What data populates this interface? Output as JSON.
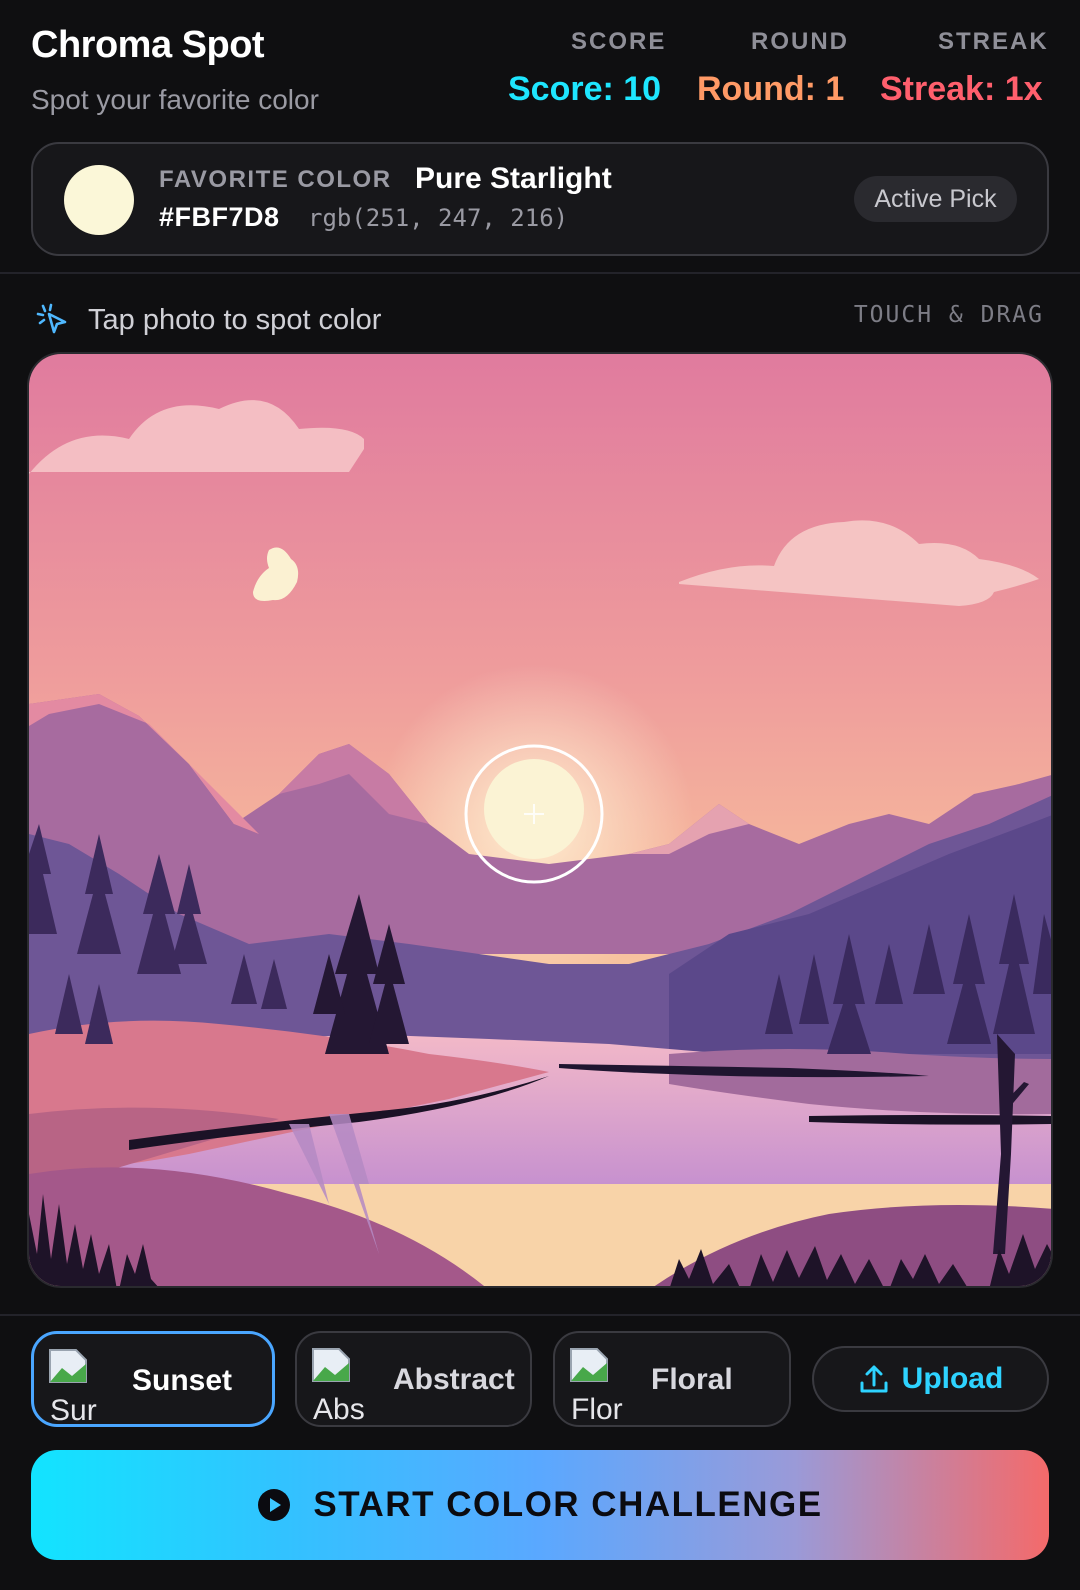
{
  "app": {
    "title": "Chroma Spot",
    "subtitle": "Spot your favorite color"
  },
  "stats": {
    "score_label": "SCORE",
    "round_label": "ROUND",
    "streak_label": "STREAK",
    "score_text": "Score: 10",
    "round_text": "Round: 1",
    "streak_text": "Streak: 1x",
    "score_color": "#1ee6ff",
    "round_color": "#ff9a66",
    "streak_color": "#ff5f6d"
  },
  "favorite": {
    "label": "FAVORITE COLOR",
    "name": "Pure Starlight",
    "hex": "#FBF7D8",
    "rgb": "rgb(251, 247, 216)",
    "swatch_color": "#FBF7D8",
    "status": "Active Pick"
  },
  "picker": {
    "instruction": "Tap photo to spot color",
    "hint": "TOUCH & DRAG",
    "icon": "pointer-click-icon"
  },
  "themes": [
    {
      "label": "Sunset",
      "broken_alt": "Sur",
      "active": true
    },
    {
      "label": "Abstract",
      "broken_alt": "Abs",
      "active": false
    },
    {
      "label": "Floral",
      "broken_alt": "Flor",
      "active": false
    }
  ],
  "upload": {
    "label": "Upload",
    "icon": "upload-icon"
  },
  "start": {
    "label": "START COLOR CHALLENGE",
    "icon": "play-icon"
  }
}
